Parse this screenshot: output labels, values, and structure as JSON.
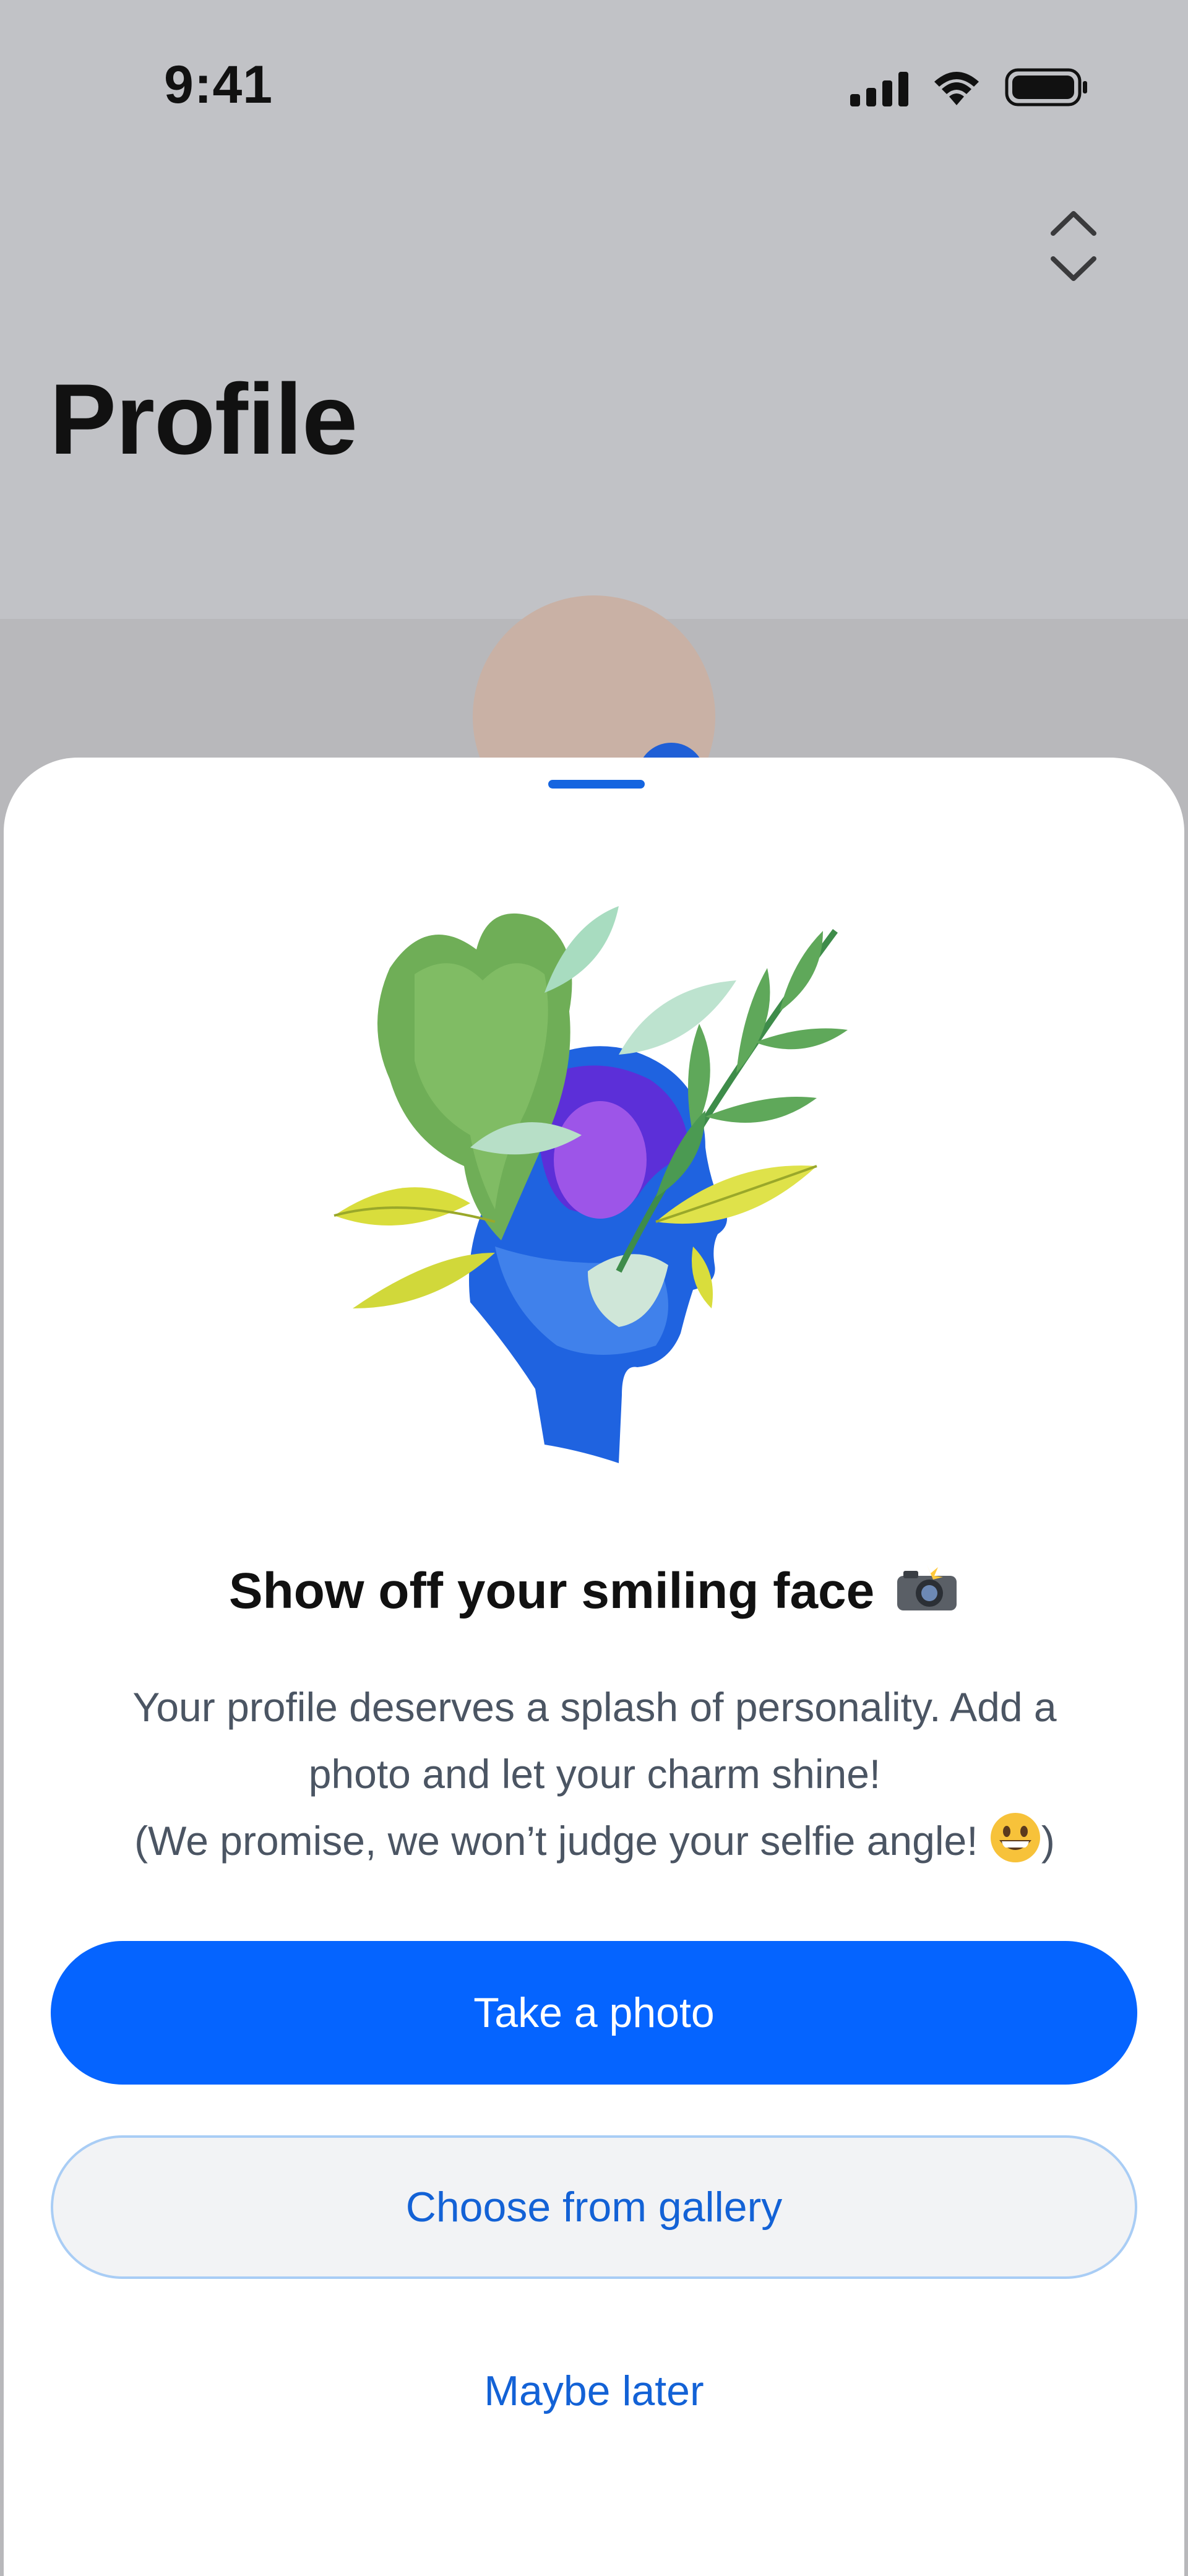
{
  "status_bar": {
    "time": "9:41",
    "icons": [
      "cellular-signal-icon",
      "wifi-icon",
      "battery-icon"
    ]
  },
  "header": {
    "title": "Profile",
    "switcher_icon": "chevron-up-down-icon"
  },
  "sheet": {
    "illustration": "head-with-leaves-illustration",
    "headline": "Show off your smiling face",
    "headline_emoji": "camera-with-flash-emoji",
    "body_line_1": "Your profile deserves a splash of personality. Add a",
    "body_line_2": "photo and let your charm shine!",
    "body_line_3": "(We promise, we won’t judge your selfie angle!",
    "body_line_3_end": ")",
    "body_emoji": "grinning-face-emoji",
    "primary_button": "Take a photo",
    "secondary_button": "Choose from gallery",
    "tertiary_button": "Maybe later"
  },
  "colors": {
    "primary": "#0564FF",
    "link": "#1362D6",
    "backdrop": "#C1C2C6",
    "sheet": "#FFFFFF"
  }
}
